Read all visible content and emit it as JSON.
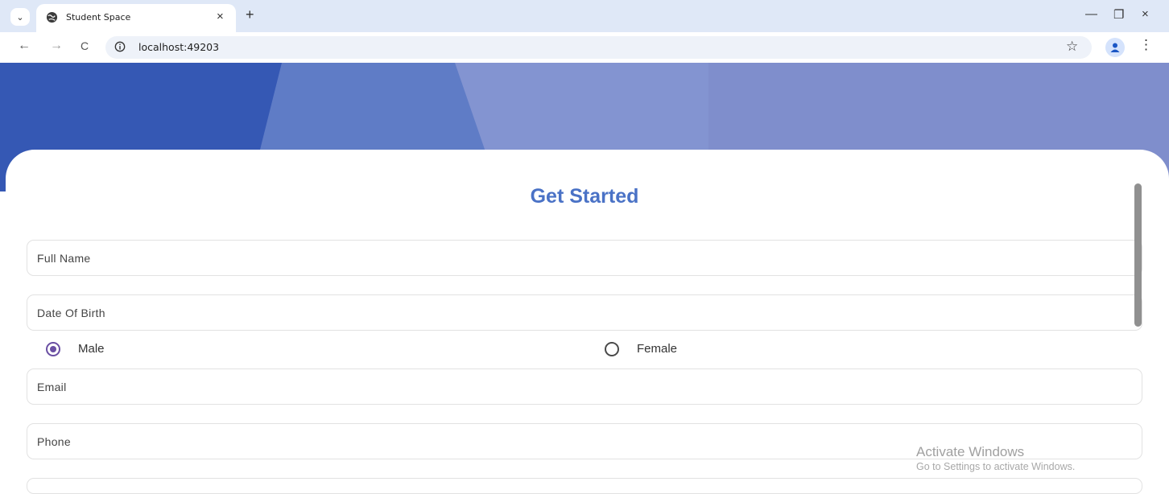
{
  "browser": {
    "tab_title": "Student Space",
    "tab_close": "×",
    "new_tab": "+",
    "tab_list": "⌄",
    "url": "localhost:49203",
    "window_controls": {
      "minimize": "—",
      "restore": "❐",
      "close": "×"
    },
    "nav": {
      "back": "←",
      "forward": "→",
      "reload": "C"
    },
    "bookmark_icon": "☆",
    "menu_icon": "⋮"
  },
  "page": {
    "title": "Get Started",
    "fields": {
      "full_name": {
        "label": "Full Name"
      },
      "dob": {
        "label": "Date Of Birth"
      },
      "email": {
        "label": "Email"
      },
      "phone": {
        "label": "Phone"
      }
    },
    "gender": {
      "options": [
        {
          "label": "Male",
          "selected": true
        },
        {
          "label": "Female",
          "selected": false
        }
      ]
    },
    "colors": {
      "accent": "#4a72c6",
      "radio_selected": "#6a4fa3",
      "hero_dark": "#3558b4",
      "hero_light": "#8394d1"
    }
  },
  "os_watermark": {
    "title": "Activate Windows",
    "subtitle": "Go to Settings to activate Windows."
  }
}
